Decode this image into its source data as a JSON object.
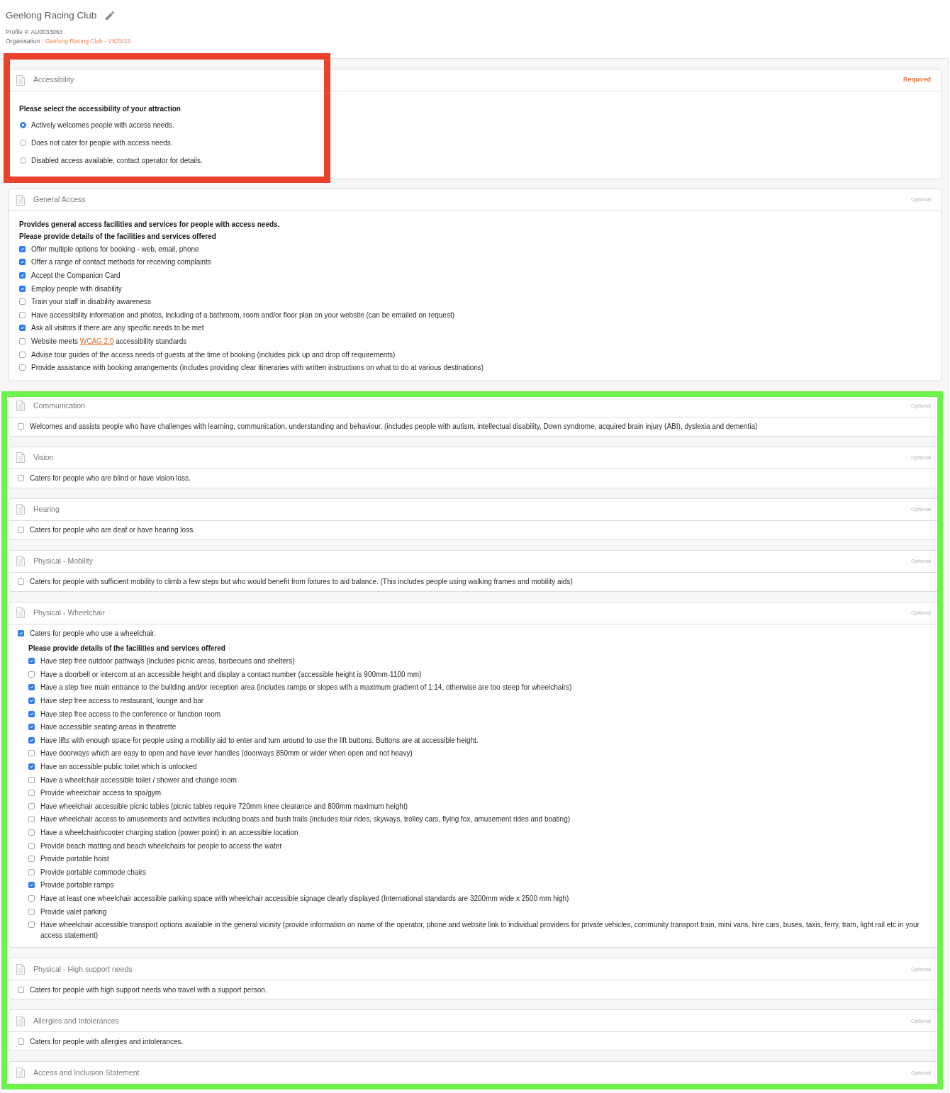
{
  "header": {
    "title": "Geelong Racing Club",
    "profile": "Profile #: AU0033063",
    "organisation_label": "Organisation :",
    "organisation_link": "Geelong Racing Club - VICBI15"
  },
  "groups": [
    {
      "frame": {
        "kind": "partial",
        "color": "#e9412b"
      },
      "sections": [
        {
          "title": "Accessibility",
          "required": true,
          "status": "Required",
          "kind": "radio",
          "question": "Please select the accessibility of your attraction",
          "options": [
            {
              "label": "Actively welcomes people with access needs.",
              "selected": true
            },
            {
              "label": "Does not cater for people with access needs.",
              "selected": false
            },
            {
              "label": "Disabled access available, contact operator for details.",
              "selected": false
            }
          ]
        }
      ]
    },
    {
      "sections": [
        {
          "title": "General Access",
          "required": false,
          "status": "Optional",
          "kind": "checkbox",
          "intro": "Provides general access facilities and services for people with access needs.",
          "details_heading": "Please provide details of the facilities and services offered",
          "options": [
            {
              "label": "Offer multiple options for booking - web, email, phone",
              "checked": true
            },
            {
              "label": "Offer a range of contact methods for receiving complaints",
              "checked": true
            },
            {
              "label": "Accept the Companion Card",
              "checked": true
            },
            {
              "label": "Employ people with disability",
              "checked": true
            },
            {
              "label": "Train your staff in disability awareness",
              "checked": false
            },
            {
              "label": "Have accessibility information and photos, including of a bathroom, room and/or floor plan on your website (can be emailed on request)",
              "checked": false
            },
            {
              "label": "Ask all visitors if there are any specific needs to be met",
              "checked": true
            },
            {
              "label": "Website meets",
              "link": "WCAG 2.0",
              "label_after": "accessibility standards",
              "checked": false
            },
            {
              "label": "Advise tour guides of the access needs of guests at the time of booking (includes pick up and drop off requirements)",
              "checked": false
            },
            {
              "label": "Provide assistance with booking arrangements (includes providing clear itineraries with written instructions on what to do at various destinations)",
              "checked": false
            }
          ]
        }
      ]
    },
    {
      "frame": {
        "kind": "full",
        "color": "#6df24b"
      },
      "sections": [
        {
          "title": "Communication",
          "required": false,
          "status": "Optional",
          "kind": "checkbox",
          "options": [
            {
              "label": "Welcomes and assists people who have challenges with learning, communication, understanding and behaviour. (includes people with autism, intellectual disability, Down syndrome, acquired brain injury (ABI), dyslexia and dementia)",
              "checked": false
            }
          ]
        },
        {
          "title": "Vision",
          "required": false,
          "status": "Optional",
          "kind": "checkbox",
          "options": [
            {
              "label": "Caters for people who are blind or have vision loss.",
              "checked": false
            }
          ]
        },
        {
          "title": "Hearing",
          "required": false,
          "status": "Optional",
          "kind": "checkbox",
          "options": [
            {
              "label": "Caters for people who are deaf or have hearing loss.",
              "checked": false
            }
          ]
        },
        {
          "title": "Physical - Mobility",
          "required": false,
          "status": "Optional",
          "kind": "checkbox",
          "options": [
            {
              "label": "Caters for people with sufficient mobility to climb a few steps but who would benefit from fixtures to aid balance. (This includes people using walking frames and mobility aids)",
              "checked": false
            }
          ]
        },
        {
          "title": "Physical - Wheelchair",
          "required": false,
          "status": "Optional",
          "kind": "checkbox",
          "options": [
            {
              "label": "Caters for people who use a wheelchair.",
              "checked": true,
              "details_heading": "Please provide details of the facilities and services offered",
              "children": [
                {
                  "label": "Have step free outdoor pathways (includes picnic areas, barbecues and shelters)",
                  "checked": true
                },
                {
                  "label": "Have a doorbell or intercom at an accessible height and display a contact number (accessible height is 900mm-1100 mm)",
                  "checked": false
                },
                {
                  "label": "Have a step free main entrance to the building and/or reception area (includes ramps or slopes with a maximum gradient of 1:14, otherwise are too steep for wheelchairs)",
                  "checked": true
                },
                {
                  "label": "Have step free access to restaurant, lounge and bar",
                  "checked": true
                },
                {
                  "label": "Have step free access to the conference or function room",
                  "checked": true
                },
                {
                  "label": "Have accessible seating areas in theatrette",
                  "checked": true
                },
                {
                  "label": "Have lifts with enough space for people using a mobility aid to enter and turn around to use the lift buttons. Buttons are at accessible height.",
                  "checked": true
                },
                {
                  "label": "Have doorways which are easy to open and have lever handles (doorways 850mm or wider when open and not heavy)",
                  "checked": false
                },
                {
                  "label": "Have an accessible public toilet which is unlocked",
                  "checked": true
                },
                {
                  "label": "Have a wheelchair accessible toilet / shower and change room",
                  "checked": false
                },
                {
                  "label": "Provide wheelchair access to spa/gym",
                  "checked": false
                },
                {
                  "label": "Have wheelchair accessible picnic tables (picnic tables require 720mm knee clearance and 800mm maximum height)",
                  "checked": false
                },
                {
                  "label": "Have wheelchair access to amusements and activities including boats and bush trails (includes tour rides, skyways, trolley cars, flying fox, amusement rides and boating)",
                  "checked": false
                },
                {
                  "label": "Have a wheelchair/scooter charging station (power point) in an accessible location",
                  "checked": false
                },
                {
                  "label": "Provide beach matting and beach wheelchairs for people to access the water",
                  "checked": false
                },
                {
                  "label": "Provide portable hoist",
                  "checked": false
                },
                {
                  "label": "Provide portable commode chairs",
                  "checked": false
                },
                {
                  "label": "Provide portable ramps",
                  "checked": true
                },
                {
                  "label": "Have at least one wheelchair accessible parking space with wheelchair accessible signage clearly displayed (International standards are 3200mm wide x 2500 mm high)",
                  "checked": false
                },
                {
                  "label": "Provide valet parking",
                  "checked": false
                },
                {
                  "label": "Have wheelchair accessible transport options available in the general vicinity (provide information on name of the operator, phone and website link to individual providers for private vehicles, community transport train, mini vans, hire cars, buses, taxis, ferry, tram, light rail etc in your access statement)",
                  "checked": false
                }
              ]
            }
          ]
        },
        {
          "title": "Physical - High support needs",
          "required": false,
          "status": "Optional",
          "kind": "checkbox",
          "options": [
            {
              "label": "Caters for people with high support needs who travel with a support person.",
              "checked": false
            }
          ]
        },
        {
          "title": "Allergies and Intolerances",
          "required": false,
          "status": "Optional",
          "kind": "checkbox",
          "options": [
            {
              "label": "Caters for people with allergies and intolerances.",
              "checked": false
            }
          ]
        },
        {
          "title": "Access and Inclusion Statement",
          "required": false,
          "status": "Optional"
        }
      ]
    }
  ]
}
